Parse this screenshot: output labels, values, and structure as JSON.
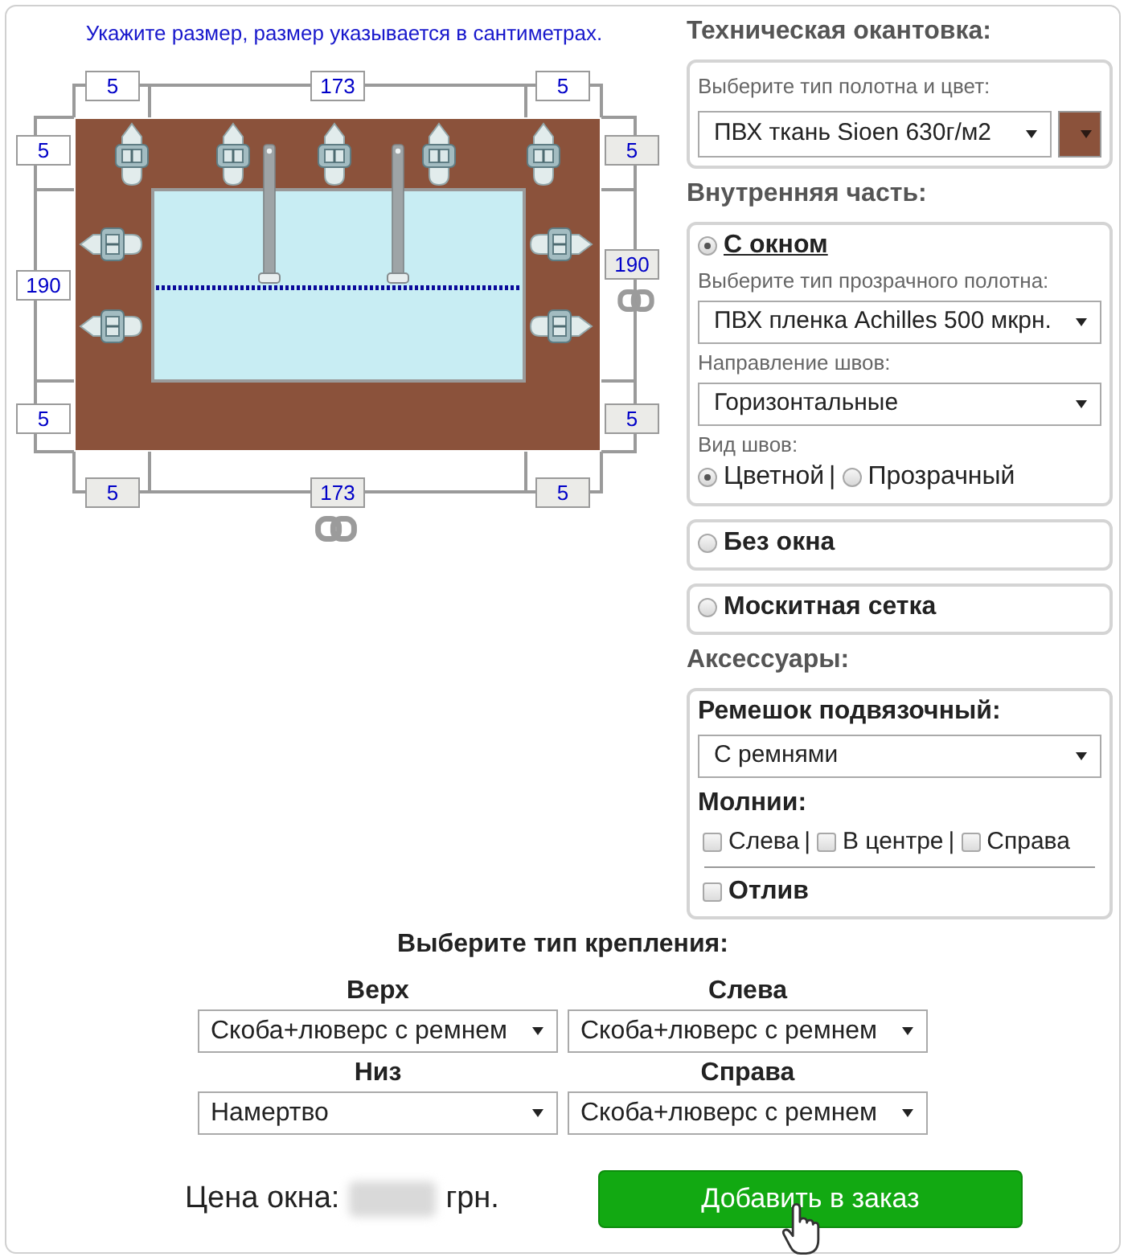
{
  "dimensions": {
    "caption": "Укажите размер, размер указывается в сантиметрах.",
    "top": [
      {
        "value": "5",
        "disabled": false
      },
      {
        "value": "173",
        "disabled": false
      },
      {
        "value": "5",
        "disabled": false
      }
    ],
    "left": [
      {
        "value": "5",
        "disabled": false
      },
      {
        "value": "190",
        "disabled": false
      },
      {
        "value": "5",
        "disabled": false
      }
    ],
    "right": [
      {
        "value": "5",
        "disabled": true
      },
      {
        "value": "190",
        "disabled": true
      },
      {
        "value": "5",
        "disabled": true
      }
    ],
    "bottom": [
      {
        "value": "5",
        "disabled": true
      },
      {
        "value": "173",
        "disabled": true
      },
      {
        "value": "5",
        "disabled": true
      }
    ]
  },
  "edging": {
    "title": "Техническая окантовка:",
    "label": "Выберите тип полотна и цвет:",
    "fabric": "ПВХ ткань Sioen 630г/м2",
    "color": "#8b523b"
  },
  "inner": {
    "title": "Внутренняя часть:",
    "options": [
      {
        "kind": "window",
        "label": "С окном",
        "selected": true,
        "film_label": "Выберите тип прозрачного полотна:",
        "film": "ПВХ пленка Achilles 500 мкрн.",
        "seam_dir_label": "Направление швов:",
        "seam_dir": "Горизонтальные",
        "seam_type_label": "Вид швов:",
        "seam_types": [
          {
            "label": "Цветной",
            "selected": true
          },
          {
            "label": "Прозрачный",
            "selected": false
          }
        ],
        "separator": "|"
      },
      {
        "kind": "plain",
        "label": "Без окна",
        "selected": false
      },
      {
        "kind": "plain",
        "label": "Москитная сетка",
        "selected": false
      }
    ]
  },
  "accessories": {
    "title": "Аксессуары:",
    "strap_label": "Ремешок подвязочный:",
    "strap": "С ремнями",
    "zip_label": "Молнии:",
    "zips": [
      {
        "label": "Слева",
        "checked": false
      },
      {
        "label": "В центре",
        "checked": false
      },
      {
        "label": "Справа",
        "checked": false
      }
    ],
    "separator": "|",
    "drip": {
      "label": "Отлив",
      "checked": false
    }
  },
  "mounting": {
    "title": "Выберите тип крепления:",
    "sides": [
      {
        "label": "Верх",
        "value": "Скоба+люверс с ремнем"
      },
      {
        "label": "Слева",
        "value": "Скоба+люверс с ремнем"
      },
      {
        "label": "Низ",
        "value": "Намертво"
      },
      {
        "label": "Справа",
        "value": "Скоба+люверс с ремнем"
      }
    ]
  },
  "price": {
    "label": "Цена окна:",
    "currency": "грн."
  },
  "order_button": "Добавить в заказ"
}
